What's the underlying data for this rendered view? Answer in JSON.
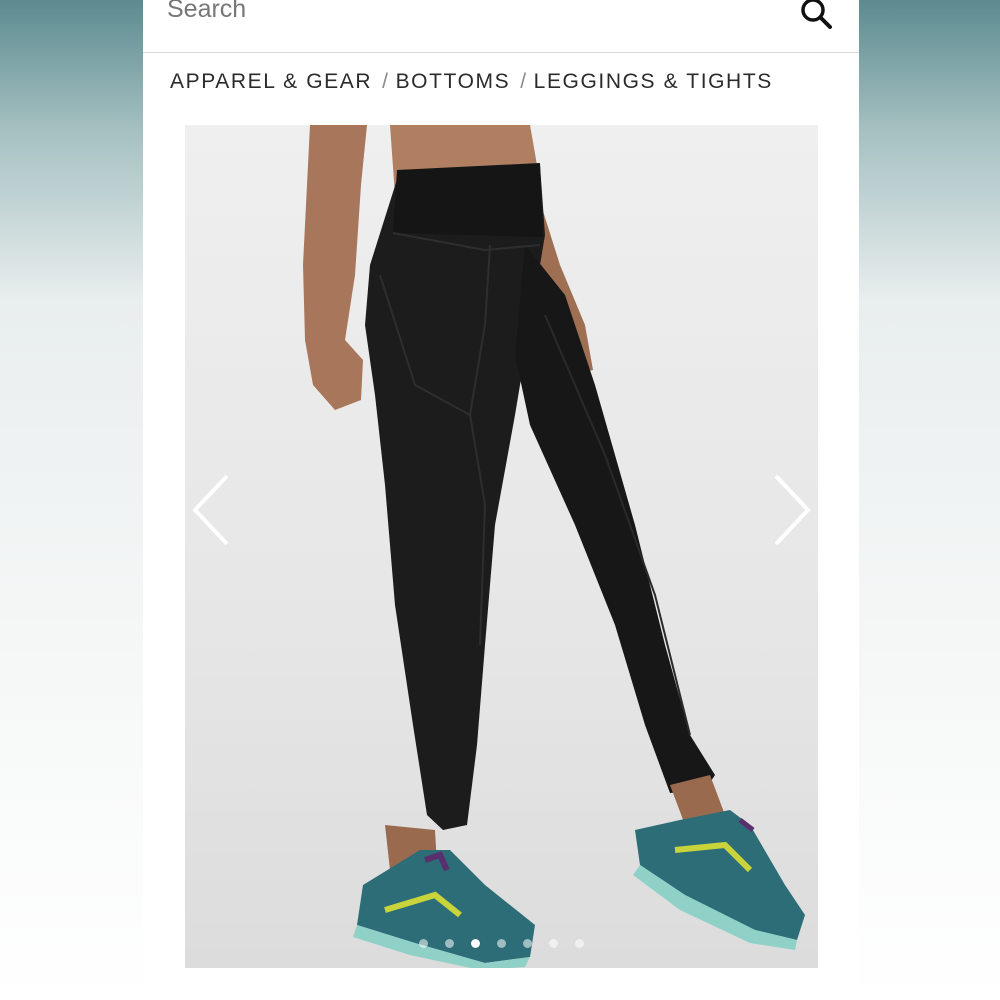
{
  "search": {
    "placeholder": "Search",
    "icon": "search-icon"
  },
  "breadcrumb": [
    {
      "label": "APPAREL & GEAR"
    },
    {
      "label": "BOTTOMS"
    },
    {
      "label": "LEGGINGS & TIGHTS"
    }
  ],
  "breadcrumb_separator": "/",
  "gallery": {
    "prev_icon": "chevron-left-icon",
    "next_icon": "chevron-right-icon",
    "dot_count": 7,
    "active_dot": 3
  },
  "colors": {
    "background_top": "#5f8f93",
    "panel": "#ffffff",
    "text": "#2b2b2b",
    "legging": "#1b1b1b",
    "shoe": "#2f6f78",
    "shoe_accent": "#c9d43a"
  }
}
